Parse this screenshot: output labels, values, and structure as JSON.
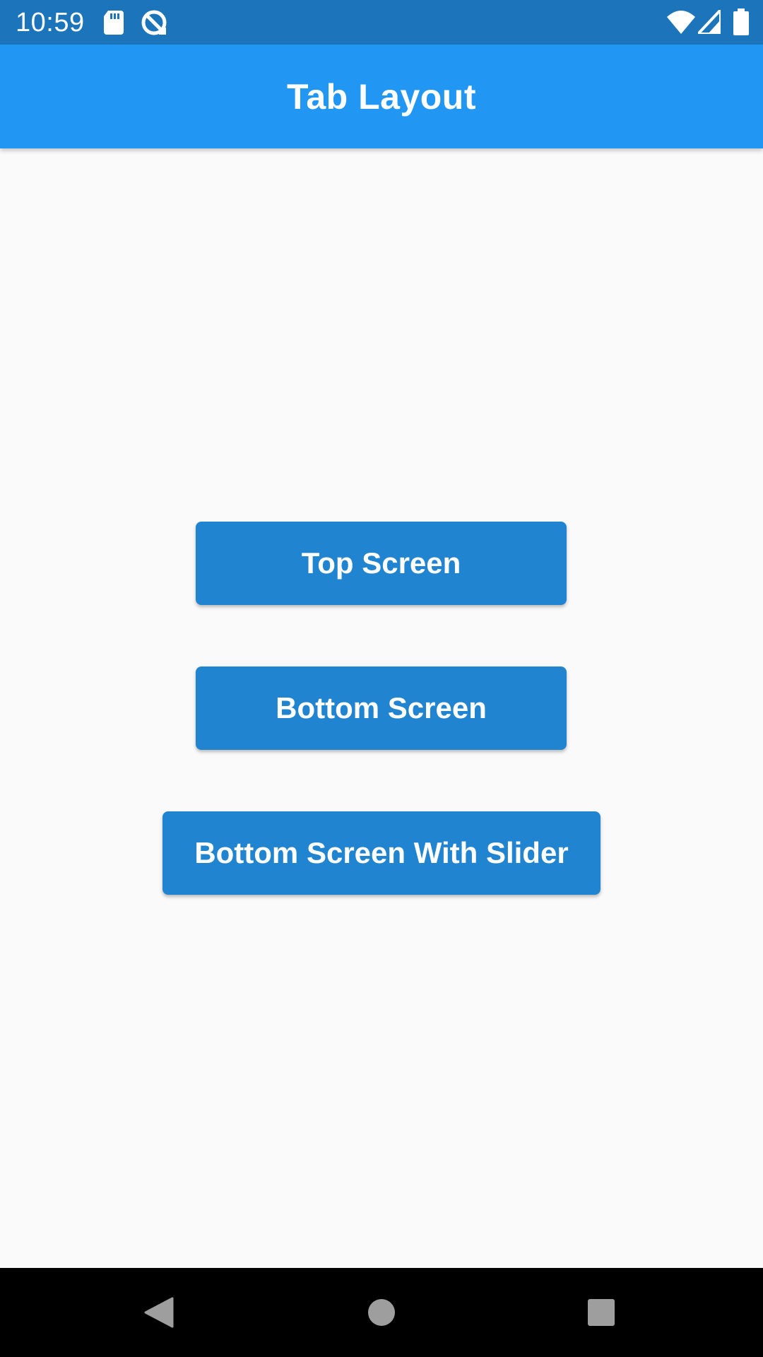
{
  "status_bar": {
    "time": "10:59",
    "icons": [
      "sd-card-icon",
      "data-saver-icon",
      "wifi-icon",
      "cell-signal-icon",
      "battery-icon"
    ],
    "background": "#1c74bb"
  },
  "app_bar": {
    "title": "Tab Layout",
    "background": "#2196f3"
  },
  "main": {
    "buttons": [
      {
        "label": "Top Screen"
      },
      {
        "label": "Bottom Screen"
      },
      {
        "label": "Bottom Screen With Slider"
      }
    ],
    "button_color": "#2184d0"
  },
  "nav_bar": {
    "buttons": [
      "back-icon",
      "home-icon",
      "recents-icon"
    ]
  }
}
